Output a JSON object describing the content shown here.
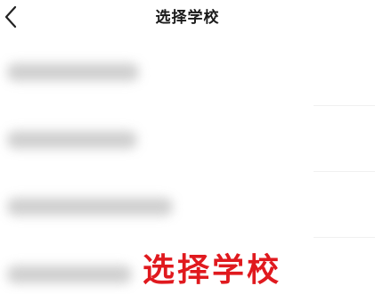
{
  "header": {
    "title": "选择学校",
    "back_icon": "chevron-left-icon"
  },
  "school_list": {
    "items": [
      {
        "name": ""
      },
      {
        "name": ""
      },
      {
        "name": ""
      },
      {
        "name": ""
      }
    ]
  },
  "overlay": {
    "caption": "选择学校",
    "caption_color": "#e0191e"
  }
}
